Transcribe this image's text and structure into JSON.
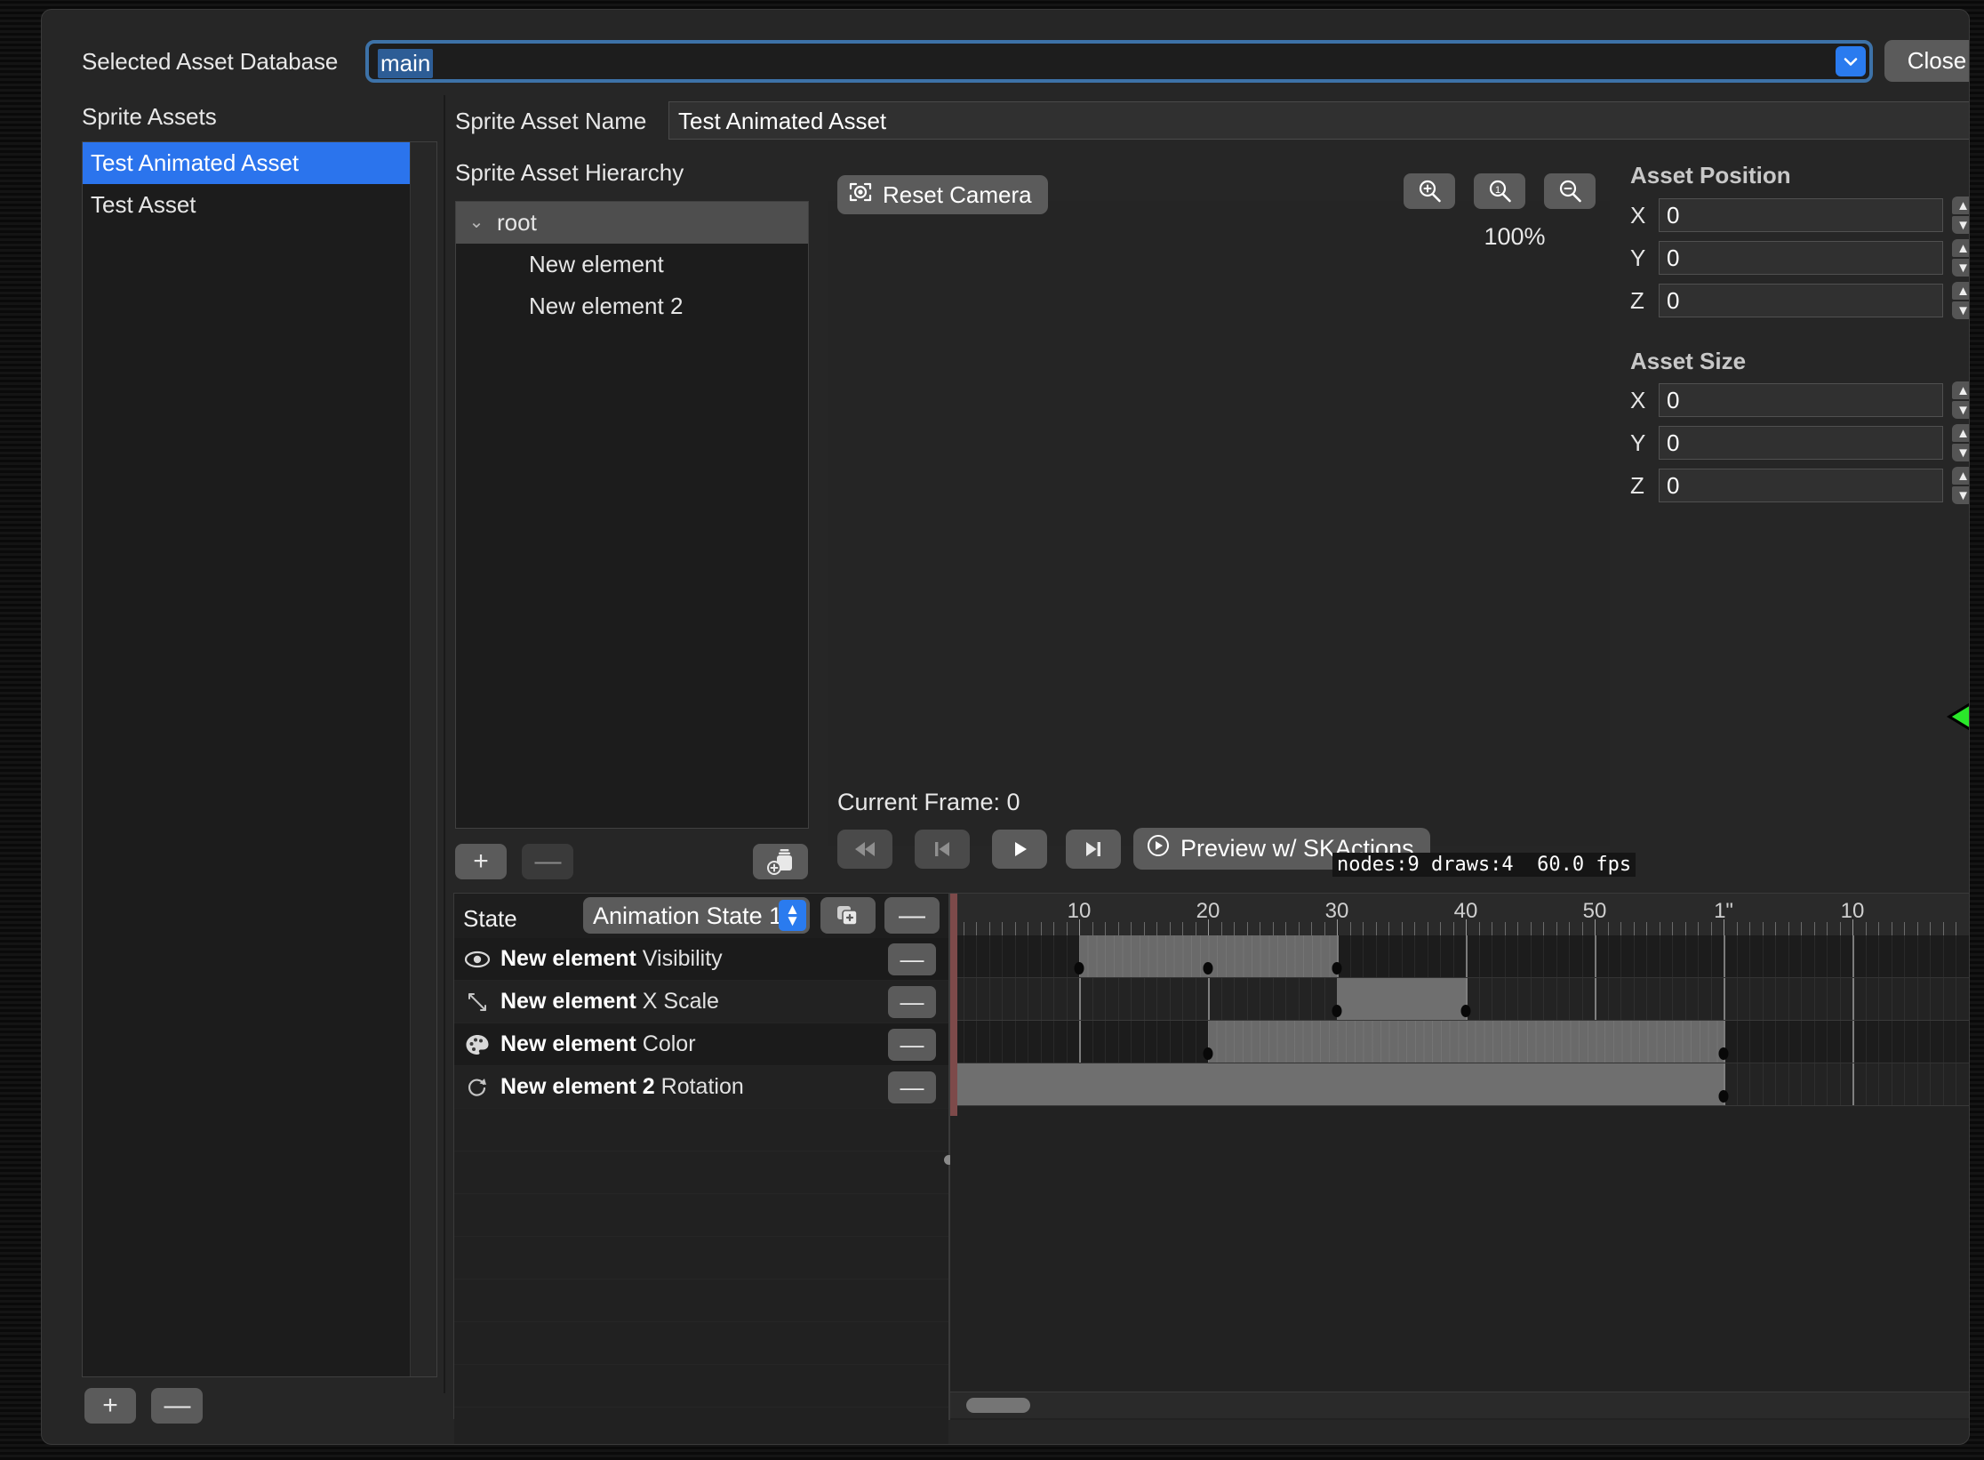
{
  "window": {
    "database_label": "Selected Asset Database",
    "database_value": "main",
    "close_label": "Close"
  },
  "sidebar": {
    "title": "Sprite Assets",
    "assets": [
      {
        "label": "Test Animated Asset",
        "selected": true
      },
      {
        "label": "Test Asset",
        "selected": false
      }
    ],
    "add_label": "+",
    "remove_label": "—"
  },
  "asset": {
    "name_label": "Sprite Asset Name",
    "name_value": "Test Animated Asset"
  },
  "hierarchy": {
    "title": "Sprite Asset Hierarchy",
    "nodes": [
      {
        "label": "root",
        "depth": 0,
        "selected": true,
        "expanded": true
      },
      {
        "label": "New element",
        "depth": 1,
        "selected": false
      },
      {
        "label": "New element 2",
        "depth": 1,
        "selected": false
      }
    ],
    "add_label": "+",
    "remove_label": "—"
  },
  "viewport": {
    "reset_camera_label": "Reset Camera",
    "zoom_percent": "100%",
    "zoom_in_title": "zoom-in",
    "zoom_one_title": "zoom-actual",
    "zoom_out_title": "zoom-out"
  },
  "playback": {
    "current_frame_label": "Current Frame: 0",
    "preview_label": "Preview w/ SKActions",
    "stats": "nodes:9 draws:4  60.0 fps"
  },
  "timeline": {
    "state_label": "State",
    "state_value": "Animation State 1",
    "duplicate_label": "duplicate-state",
    "delete_label": "—",
    "track_remove_label": "—",
    "tracks": [
      {
        "element": "New element",
        "property": "Visibility",
        "icon": "eye-icon"
      },
      {
        "element": "New element",
        "property": "X Scale",
        "icon": "scale-icon"
      },
      {
        "element": "New element",
        "property": "Color",
        "icon": "palette-icon"
      },
      {
        "element": "New element 2",
        "property": "Rotation",
        "icon": "rotation-icon"
      }
    ],
    "ruler_ticks": [
      {
        "label": "10",
        "frame": 10
      },
      {
        "label": "20",
        "frame": 20
      },
      {
        "label": "30",
        "frame": 30
      },
      {
        "label": "40",
        "frame": 40
      },
      {
        "label": "50",
        "frame": 50
      },
      {
        "label": "1\"",
        "frame": 60
      },
      {
        "label": "10",
        "frame": 70
      }
    ],
    "frames_visible": 80,
    "track_segments": [
      [
        {
          "start": 10,
          "end": 30
        }
      ],
      [
        {
          "start": 30,
          "end": 40
        }
      ],
      [
        {
          "start": 20,
          "end": 60
        }
      ],
      [
        {
          "start": 0,
          "end": 60
        }
      ]
    ],
    "keyframes": [
      [
        10,
        20,
        30
      ],
      [
        30,
        40
      ],
      [
        20,
        60
      ],
      [
        0,
        60
      ]
    ],
    "playhead_frame": 0
  },
  "inspector": {
    "position_title": "Asset Position",
    "position_fields": [
      {
        "axis": "X",
        "value": "0"
      },
      {
        "axis": "Y",
        "value": "0"
      },
      {
        "axis": "Z",
        "value": "0"
      }
    ],
    "size_title": "Asset Size",
    "size_fields": [
      {
        "axis": "X",
        "value": "0"
      },
      {
        "axis": "Y",
        "value": "0"
      },
      {
        "axis": "Z",
        "value": "0"
      }
    ]
  },
  "colors": {
    "accent_blue": "#2a7bef",
    "selection_blue": "#2b74ed",
    "field_border_blue": "#3d72a8",
    "button_grey": "#5b5b5b",
    "panel_bg": "#262626",
    "playhead_red": "#7d4a4a"
  }
}
